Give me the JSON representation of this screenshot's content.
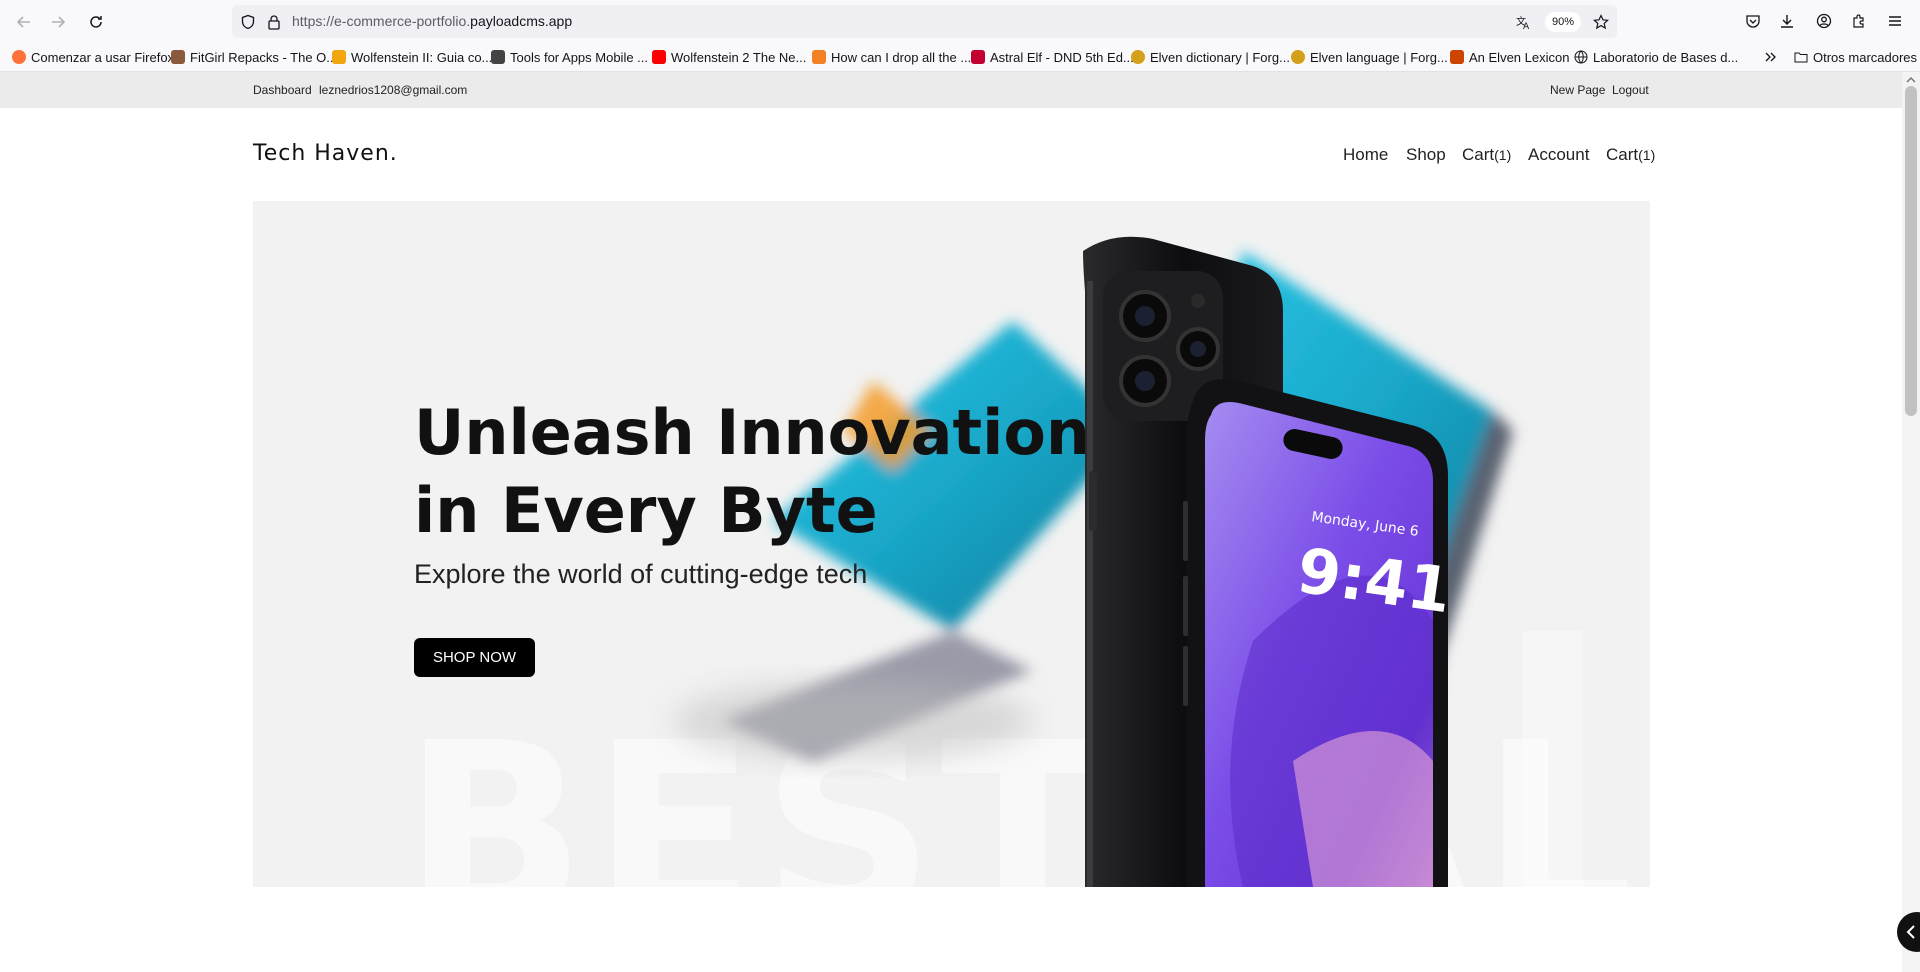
{
  "browser": {
    "url_prefix": "https://e-commerce-portfolio.",
    "url_domain": "payloadcms.app",
    "zoom": "90%"
  },
  "bookmarks": [
    {
      "label": "Comenzar a usar Firefox",
      "color": "#ff7139"
    },
    {
      "label": "FitGirl Repacks - The O...",
      "color": "#8a5a3c"
    },
    {
      "label": "Wolfenstein II: Guia co...",
      "color": "#f2a60d"
    },
    {
      "label": "Tools for Apps Mobile ...",
      "color": "#444444"
    },
    {
      "label": "Wolfenstein 2 The Ne...",
      "color": "#ff0000"
    },
    {
      "label": "How can I drop all the ...",
      "color": "#f48024"
    },
    {
      "label": "Astral Elf - DND 5th Ed...",
      "color": "#c3002f"
    },
    {
      "label": "Elven dictionary | Forg...",
      "color": "#d4a017"
    },
    {
      "label": "Elven language | Forg...",
      "color": "#d4a017"
    },
    {
      "label": "An Elven Lexicon",
      "color": "#cc4400"
    },
    {
      "label": "Laboratorio de Bases d...",
      "color": "#666666"
    }
  ],
  "bookmarks_folder": "Otros marcadores",
  "admin": {
    "dashboard": "Dashboard",
    "email": "leznedrios1208@gmail.com",
    "new_page": "New Page",
    "logout": "Logout"
  },
  "site": {
    "logo": "Tech Haven.",
    "nav": {
      "home": "Home",
      "shop": "Shop",
      "cart": "Cart",
      "cart_count": "(1)",
      "account": "Account",
      "cart2": "Cart",
      "cart2_count": "(1)"
    }
  },
  "hero": {
    "title_line1": "Unleash Innovation",
    "title_line2": "in Every Byte",
    "subtitle": "Explore the world of cutting-edge tech",
    "cta": "SHOP NOW",
    "watermark": "BESTSALE",
    "phone_date": "Monday, June 6",
    "phone_time": "9:41"
  },
  "colors": {
    "hero_bg": "#f2f2f2",
    "cta_bg": "#000000",
    "phone_screen": "#7b4de8"
  }
}
